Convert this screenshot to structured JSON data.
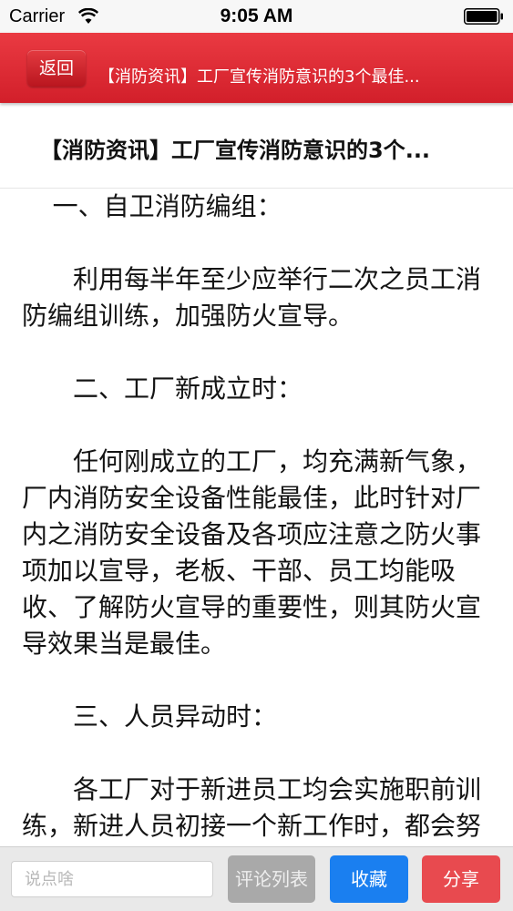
{
  "status_bar": {
    "carrier": "Carrier",
    "time": "9:05 AM"
  },
  "nav": {
    "back_label": "返回",
    "title": "【消防资讯】工厂宣传消防意识的3个最佳..."
  },
  "article": {
    "title": "【消防资讯】工厂宣传消防意识的3个...",
    "paragraphs": [
      "一、自卫消防编组：",
      "利用每半年至少应举行二次之员工消防编组训练，加强防火宣导。",
      "二、工厂新成立时：",
      "任何刚成立的工厂，均充满新气象，厂内消防安全设备性能最佳，此时针对厂内之消防安全设备及各项应注意之防火事项加以宣导，老板、干部、员工均能吸收、了解防火宣导的重要性，则其防火宣导效果当是最佳。",
      "三、人员异动时：",
      "各工厂对于新进员工均会实施职前训练，新进人员初接一个新工作时，都会努力学习，此时将防火宣导"
    ]
  },
  "bottom_bar": {
    "comment_placeholder": "说点啥",
    "comments_label": "评论列表",
    "favorite_label": "收藏",
    "share_label": "分享"
  },
  "colors": {
    "nav_red": "#d9262f",
    "favorite_blue": "#1a7ff0",
    "share_red": "#e84a4f",
    "comments_gray": "#a9a9a9"
  }
}
